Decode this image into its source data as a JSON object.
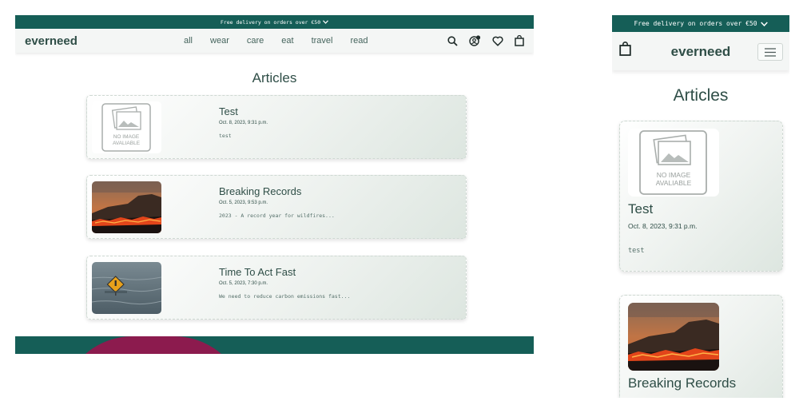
{
  "promo": {
    "text": "Free delivery on orders over €50",
    "chevron": "⌄"
  },
  "brand": "everneed",
  "nav": {
    "items": [
      "all",
      "wear",
      "care",
      "eat",
      "travel",
      "read"
    ]
  },
  "icons": {
    "search": "search-icon",
    "account": "account-icon",
    "wishlist": "heart-icon",
    "bag": "shopping-bag-icon",
    "menu": "hamburger-icon"
  },
  "page_title": "Articles",
  "articles": [
    {
      "title": "Test",
      "date": "Oct. 8, 2023, 9:31 p.m.",
      "excerpt": "test",
      "image": "no-image-placeholder",
      "placeholder_text": "NO IMAGE\nAVALIABLE"
    },
    {
      "title": "Breaking Records",
      "date": "Oct. 5, 2023, 9:53 p.m.",
      "excerpt": "2023 - A record year for wildfires...",
      "image": "wildfire-photo"
    },
    {
      "title": "Time To Act Fast",
      "date": "Oct. 5, 2023, 7:30 p.m.",
      "excerpt": "We need to reduce carbon emissions fast...",
      "image": "flooded-road-sign-photo"
    }
  ],
  "mobile": {
    "articles": [
      {
        "title": "Test",
        "date": "Oct. 8, 2023, 9:31 p.m.",
        "excerpt": "test"
      },
      {
        "title": "Breaking Records"
      }
    ]
  },
  "colors": {
    "primary": "#155e57",
    "accent": "#8c1b4e",
    "text": "#2f4e47"
  }
}
